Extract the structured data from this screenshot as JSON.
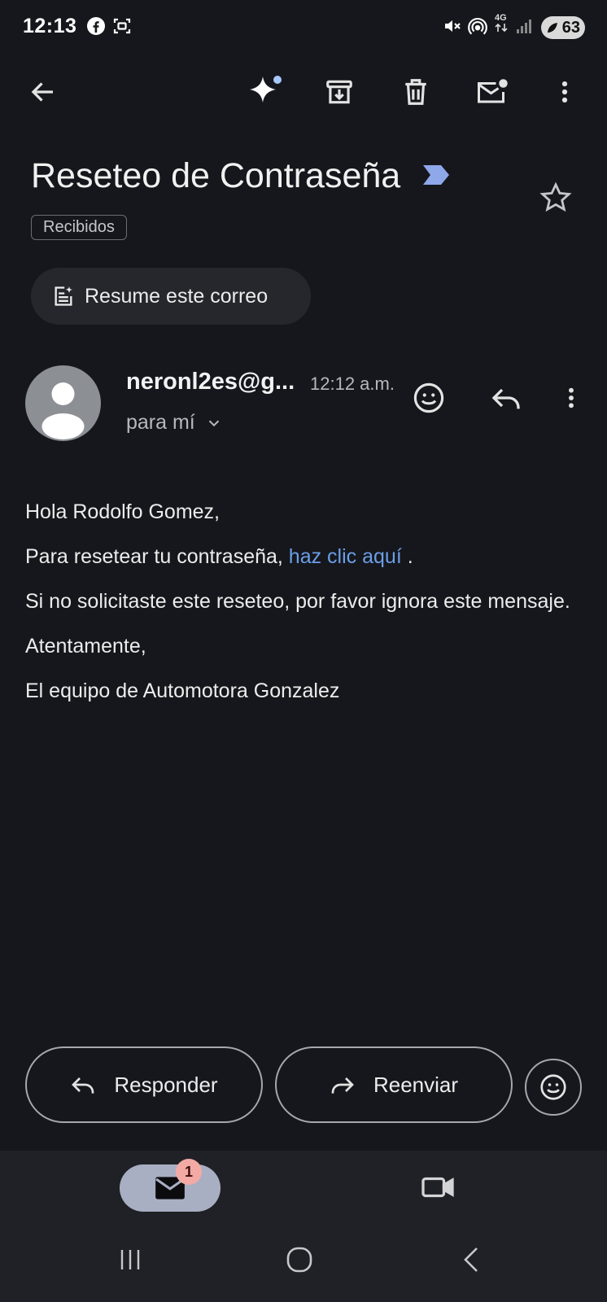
{
  "status_bar": {
    "time": "12:13",
    "network": "4G",
    "battery": "63"
  },
  "toolbar": {
    "icons": [
      "back-arrow-icon",
      "gemini-sparkle-icon",
      "archive-icon",
      "delete-icon",
      "mark-unread-icon",
      "more-vert-icon"
    ]
  },
  "email": {
    "subject": "Reseteo de Contraseña",
    "label": "Recibidos",
    "summary_button": "Resume este correo",
    "sender": "neronl2es@g...",
    "time": "12:12 a.m.",
    "recipient": "para mí",
    "body": {
      "greeting": "Hola Rodolfo Gomez,",
      "line1_prefix": "Para resetear tu contraseña, ",
      "link_text": "haz clic aquí",
      "line1_suffix": " .",
      "line2": "Si no solicitaste este reseteo, por favor ignora este mensaje.",
      "closing": "Atentamente,",
      "signature": "El equipo de Automotora Gonzalez"
    }
  },
  "actions": {
    "reply": "Responder",
    "forward": "Reenviar"
  },
  "bottom_nav": {
    "mail_badge": "1"
  },
  "colors": {
    "background": "#16171c",
    "link": "#6b9ee8",
    "important_marker": "#8fa8ea",
    "nav_active": "#a9afc2"
  }
}
